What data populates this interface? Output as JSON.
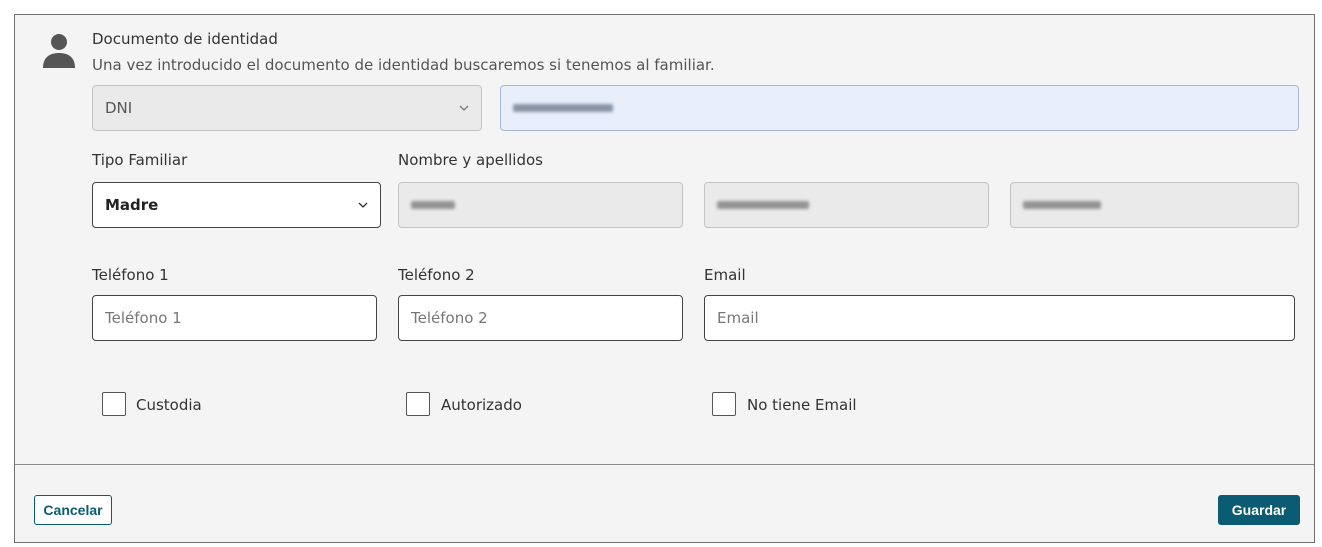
{
  "document": {
    "title": "Documento de identidad",
    "description": "Una vez introducido el documento de identidad buscaremos si tenemos al familiar.",
    "type_selected": "DNI"
  },
  "tipo_familiar": {
    "label": "Tipo Familiar",
    "selected": "Madre"
  },
  "nombre": {
    "label": "Nombre y apellidos"
  },
  "telefono1": {
    "label": "Teléfono 1",
    "placeholder": "Teléfono 1"
  },
  "telefono2": {
    "label": "Teléfono 2",
    "placeholder": "Teléfono 2"
  },
  "email": {
    "label": "Email",
    "placeholder": "Email"
  },
  "checkboxes": {
    "custodia": "Custodia",
    "autorizado": "Autorizado",
    "no_email": "No tiene Email"
  },
  "buttons": {
    "cancel": "Cancelar",
    "save": "Guardar"
  },
  "colors": {
    "primary": "#0b5c73",
    "panel": "#f4f4f4",
    "dni_input_bg": "#e8effb"
  },
  "icons": [
    "person-icon",
    "chevron-down-icon"
  ]
}
